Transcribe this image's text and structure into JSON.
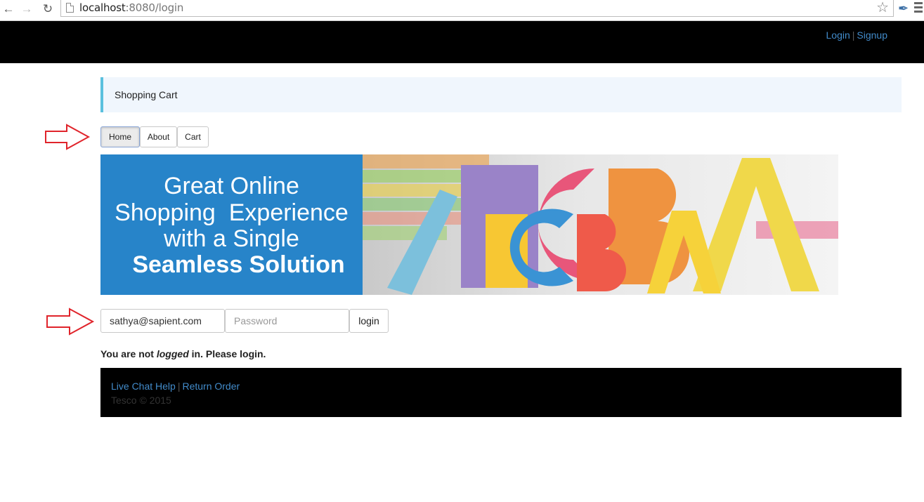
{
  "browser": {
    "url_host": "localhost",
    "url_rest": ":8080/login"
  },
  "header": {
    "login": "Login",
    "separator": "|",
    "signup": "Signup"
  },
  "title": "Shopping Cart",
  "tabs": [
    {
      "label": "Home",
      "active": true
    },
    {
      "label": "About"
    },
    {
      "label": "Cart"
    }
  ],
  "banner": {
    "line1": "Great Online",
    "line2": "Shopping  Experience",
    "line3": "with a Single",
    "line4": "Seamless Solution"
  },
  "login_form": {
    "email_value": "sathya@sapient.com",
    "password_placeholder": "Password",
    "button": "login"
  },
  "status": {
    "part1": "You are not ",
    "emphasis": "logged",
    "part2": " in. Please login."
  },
  "footer": {
    "live_chat": "Live Chat Help",
    "separator": "|",
    "return_order": "Return Order",
    "copyright": "Tesco © 2015"
  },
  "colors": {
    "link": "#428bca",
    "title_accent": "#5bc0de",
    "banner_blue": "#2784c9",
    "annotation_arrow": "#e0242b"
  }
}
